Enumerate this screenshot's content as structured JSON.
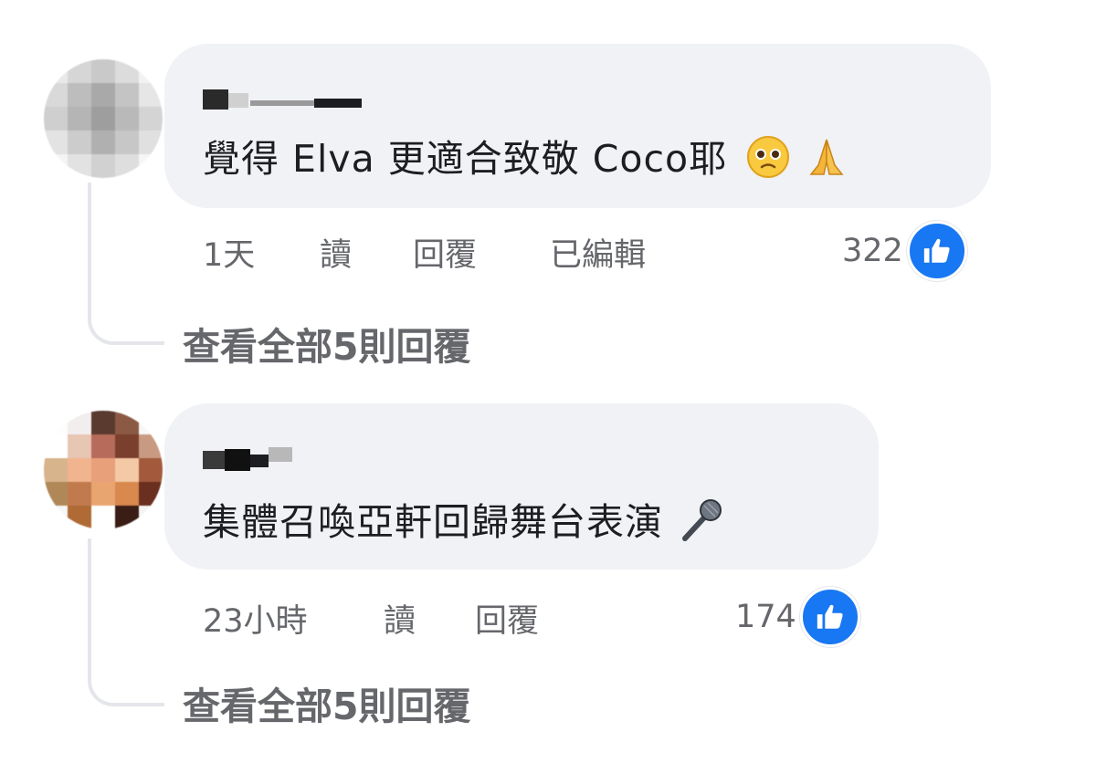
{
  "colors": {
    "bubble_bg": "#f0f2f5",
    "text_primary": "#1c1e21",
    "text_secondary": "#65676b",
    "like_blue": "#1877f2",
    "thread_line": "#e4e6eb"
  },
  "comments": [
    {
      "text": "覺得 Elva 更適合致敬 Coco耶",
      "emojis": [
        "pleading-face-icon",
        "folded-hands-icon"
      ],
      "time": "1天",
      "read_label": "讀",
      "reply_label": "回覆",
      "edited_label": "已編輯",
      "like_count": "322",
      "view_replies": "查看全部5則回覆"
    },
    {
      "text": "集體召喚亞軒回歸舞台表演",
      "emojis": [
        "microphone-icon"
      ],
      "time": "23小時",
      "read_label": "讀",
      "reply_label": "回覆",
      "like_count": "174",
      "view_replies": "查看全部5則回覆"
    }
  ]
}
